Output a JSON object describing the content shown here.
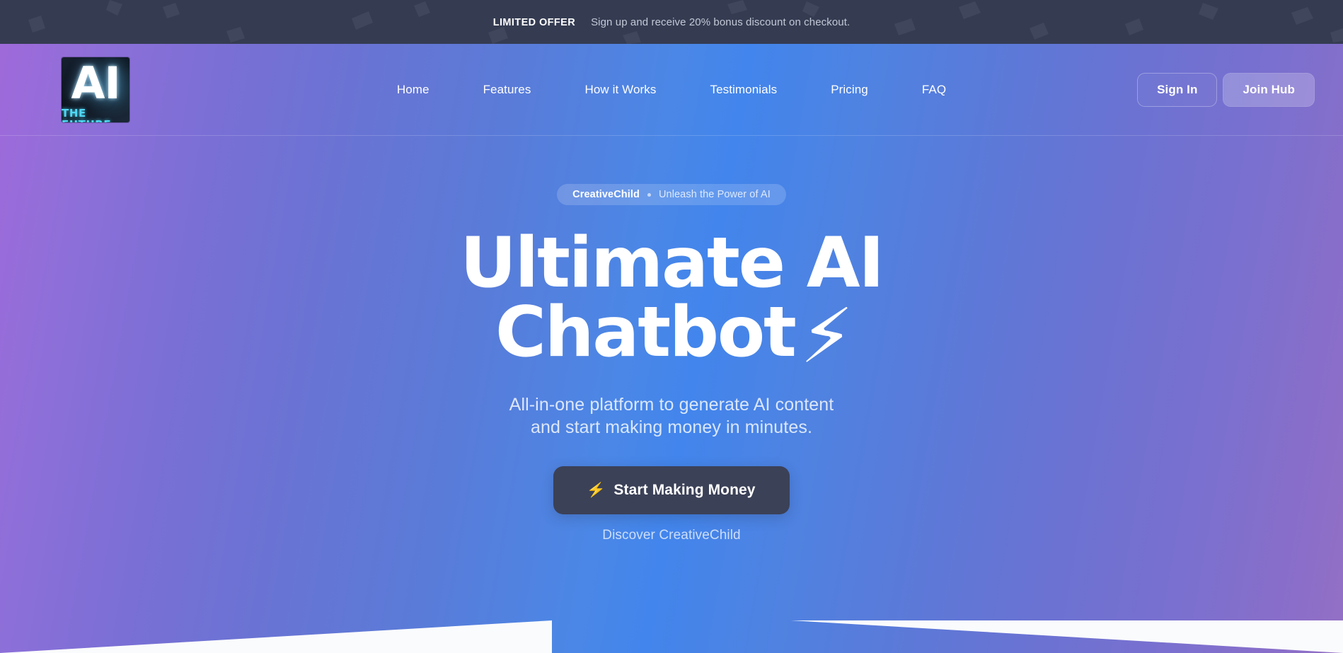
{
  "announcement": {
    "tag": "LIMITED OFFER",
    "message": "Sign up and receive 20% bonus discount on checkout.",
    "bg_color": "#353c52",
    "tag_color": "#ffffff",
    "message_color": "#c3c8d6"
  },
  "brand": {
    "logo_primary": "AI",
    "logo_tagline": "THE FUTURE",
    "logo_icon": "ai-cube-logo-icon",
    "glow_color": "#4fd8f5"
  },
  "nav": {
    "items": [
      {
        "label": "Home"
      },
      {
        "label": "Features"
      },
      {
        "label": "How it Works"
      },
      {
        "label": "Testimonials"
      },
      {
        "label": "Pricing"
      },
      {
        "label": "FAQ"
      }
    ],
    "sign_in_label": "Sign In",
    "join_label": "Join Hub"
  },
  "hero": {
    "pill_brand": "CreativeChild",
    "pill_separator": "•",
    "pill_text": "Unleash the Power of AI",
    "headline_line1": "Ultimate AI",
    "headline_line2": "Chatbot",
    "headline_bolt": "⚡",
    "subhead_line1": "All-in-one platform to generate AI content",
    "subhead_line2": "and start making money in minutes.",
    "cta_bolt": "⚡",
    "cta_label": "Start Making Money",
    "discover_label": "Discover CreativeChild",
    "gradient_start": "#a069da",
    "gradient_mid": "#4285ec",
    "gradient_end": "#9470c4",
    "cta_bg": "#3b4157"
  }
}
